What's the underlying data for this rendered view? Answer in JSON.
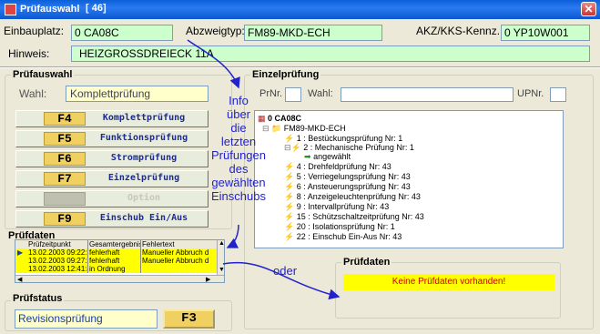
{
  "window": {
    "title": "Prüfauswahl",
    "number": "[ 46]"
  },
  "header": {
    "einbauplatz_label": "Einbauplatz:",
    "einbauplatz_value": "0 CA08C",
    "abzweigtyp_label": "Abzweigtyp:",
    "abzweigtyp_value": "FM89-MKD-ECH",
    "akz_label": "AKZ/KKS-Kennz.:",
    "akz_value": "0 YP10W001",
    "hinweis_label": "Hinweis:",
    "hinweis_value": "HEIZGROSSDREIECK 11A"
  },
  "pruefauswahl": {
    "title": "Prüfauswahl",
    "wahl_label": "Wahl:",
    "wahl_value": "Komplettprüfung",
    "buttons": [
      {
        "key": "F4",
        "label": "Komplettprüfung"
      },
      {
        "key": "F5",
        "label": "Funktionsprüfung"
      },
      {
        "key": "F6",
        "label": "Stromprüfung"
      },
      {
        "key": "F7",
        "label": "Einzelprüfung"
      },
      {
        "key": "",
        "label": "Option"
      },
      {
        "key": "F9",
        "label": "Einschub Ein/Aus"
      }
    ]
  },
  "pruefdaten": {
    "title": "Prüfdaten",
    "columns": [
      "Prüfzeitpunkt",
      "Gesamtergebnis",
      "Fehlertext"
    ],
    "rows": [
      [
        "13.02.2003 09:22:54",
        "fehlerhaft",
        "Manueller Abbruch d"
      ],
      [
        "13.02.2003 09:27:28",
        "fehlerhaft",
        "Manueller Abbruch d"
      ],
      [
        "13.02.2003 12:41:49",
        "in Ordnung",
        ""
      ]
    ]
  },
  "pruefstatus": {
    "title": "Prüfstatus",
    "value": "Revisionsprüfung",
    "button": "F3"
  },
  "einzelpruefung": {
    "title": "Einzelprüfung",
    "prnr_label": "PrNr.",
    "wahl_label": "Wahl:",
    "upnr_label": "UPNr.",
    "tree": {
      "root": "0 CA08C",
      "child": "FM89-MKD-ECH",
      "items": [
        "1 : Bestückungsprüfung Nr: 1",
        "2 : Mechanische Prüfung Nr: 1",
        "angewählt",
        "4 : Drehfeldprüfung Nr: 43",
        "5 : Verriegelungsprüfung Nr: 43",
        "6 : Ansteuerungsprüfung Nr: 43",
        "8 : Anzeigeleuchtenprüfung Nr: 43",
        "9 : Intervallprüfung Nr: 43",
        "15 : Schützschaltzeitprüfung Nr: 43",
        "20 : Isolationsprüfung Nr: 1",
        "22 : Einschub Ein-Aus Nr: 43"
      ]
    },
    "pruefdaten_title": "Prüfdaten",
    "pruefdaten_message": "Keine Prüfdaten vorhanden!"
  },
  "annotations": {
    "info_lines": [
      "Info",
      "über",
      "die",
      "letzten",
      "Prüfungen",
      "des",
      "gewählten",
      "Einschubs"
    ],
    "oder": "oder"
  },
  "colors": {
    "field_green": "#ccffcc",
    "message_yellow": "#ffff00",
    "message_text": "#cc0000",
    "key_gold": "#f0d060",
    "annotation_blue": "#2222cc"
  }
}
